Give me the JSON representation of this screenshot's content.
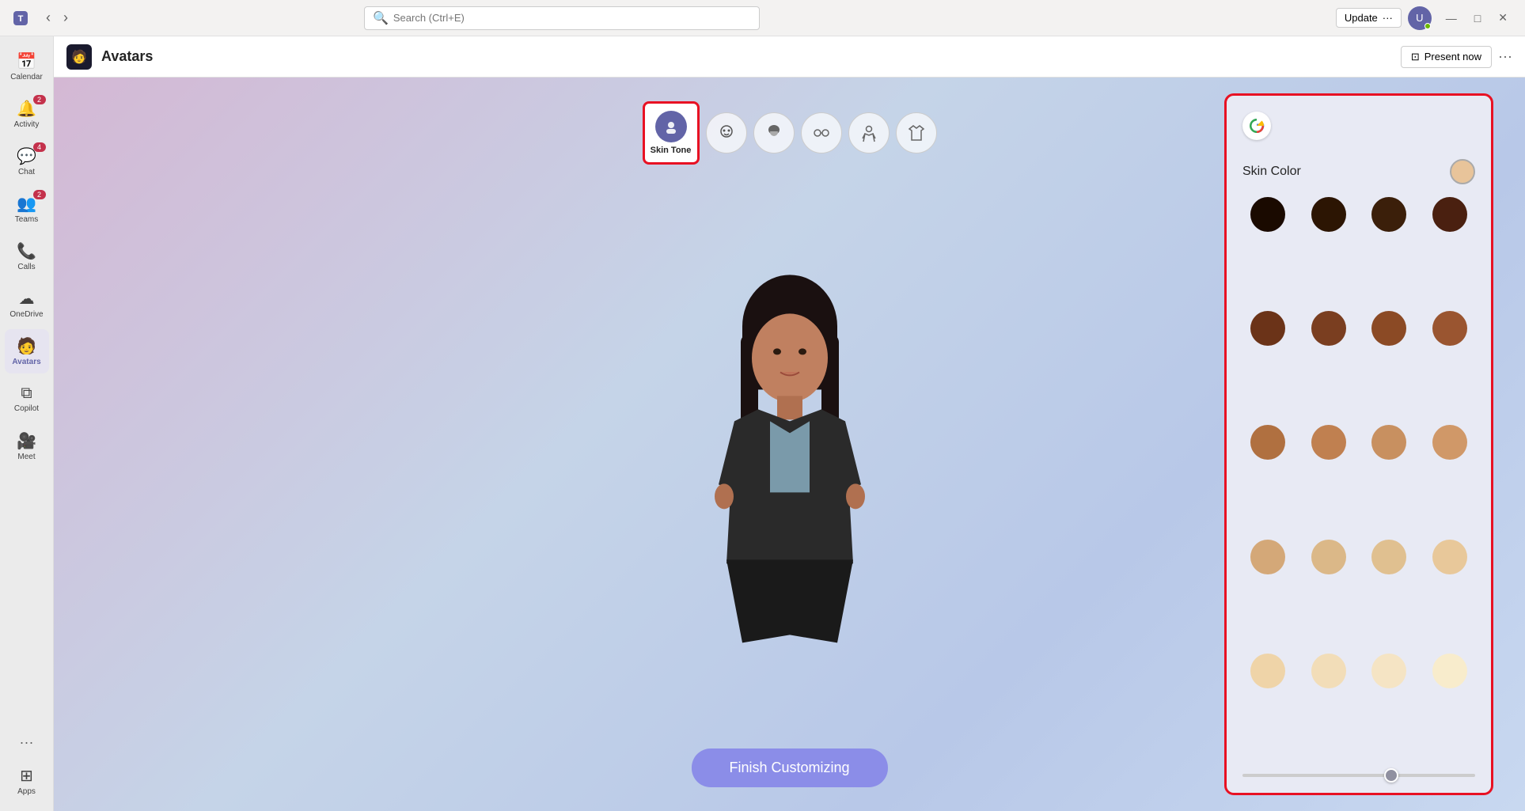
{
  "titlebar": {
    "logo": "🟣",
    "search_placeholder": "Search (Ctrl+E)",
    "update_label": "Update",
    "update_dots": "···",
    "window_controls": {
      "minimize": "—",
      "maximize": "□",
      "close": "✕"
    }
  },
  "sidebar": {
    "items": [
      {
        "id": "calendar",
        "label": "Calendar",
        "icon": "📅",
        "badge": null,
        "active": false
      },
      {
        "id": "activity",
        "label": "Activity",
        "icon": "🔔",
        "badge": "2",
        "active": false
      },
      {
        "id": "chat",
        "label": "Chat",
        "icon": "💬",
        "badge": "4",
        "active": false
      },
      {
        "id": "teams",
        "label": "Teams",
        "icon": "👥",
        "badge": "2",
        "active": false
      },
      {
        "id": "calls",
        "label": "Calls",
        "icon": "📞",
        "badge": null,
        "active": false
      },
      {
        "id": "onedrive",
        "label": "OneDrive",
        "icon": "☁",
        "badge": null,
        "active": false
      },
      {
        "id": "avatars",
        "label": "Avatars",
        "icon": "🧑",
        "badge": null,
        "active": true
      },
      {
        "id": "copilot",
        "label": "Copilot",
        "icon": "⧉",
        "badge": null,
        "active": false
      },
      {
        "id": "meet",
        "label": "Meet",
        "icon": "🎥",
        "badge": null,
        "active": false
      },
      {
        "id": "apps",
        "label": "Apps",
        "icon": "⊞",
        "badge": null,
        "active": false
      }
    ],
    "more_dots": "···"
  },
  "app_header": {
    "icon": "🧑",
    "title": "Avatars",
    "present_now_label": "Present now",
    "more_dots": "···"
  },
  "toolbar": {
    "buttons": [
      {
        "id": "skin-tone",
        "label": "Skin Tone",
        "active": true
      },
      {
        "id": "face",
        "label": "",
        "active": false
      },
      {
        "id": "hair",
        "label": "",
        "active": false
      },
      {
        "id": "accessories",
        "label": "",
        "active": false
      },
      {
        "id": "body",
        "label": "",
        "active": false
      },
      {
        "id": "clothing",
        "label": "",
        "active": false
      }
    ],
    "undo_icon": "↩",
    "redo_icon": "↪",
    "close_icon": "✕"
  },
  "skin_panel": {
    "title": "Skin Color",
    "colors_row1": [
      "#1a0a00",
      "#2c1503",
      "#3b1f0a",
      "#4a2010"
    ],
    "colors_row2": [
      "#6b3318",
      "#7a3e20",
      "#8b4a25",
      "#9a5530"
    ],
    "colors_row3": [
      "#b07040",
      "#c08050",
      "#c89060",
      "#d09868"
    ],
    "colors_row4": [
      "#d4a878",
      "#dbb888",
      "#e0c090",
      "#e8c89a"
    ],
    "colors_row5": [
      "#efd4a8",
      "#f2ddb8",
      "#f5e4c4",
      "#f8eccc"
    ],
    "slider_value": 65
  },
  "finish_button": {
    "label": "Finish Customizing"
  }
}
